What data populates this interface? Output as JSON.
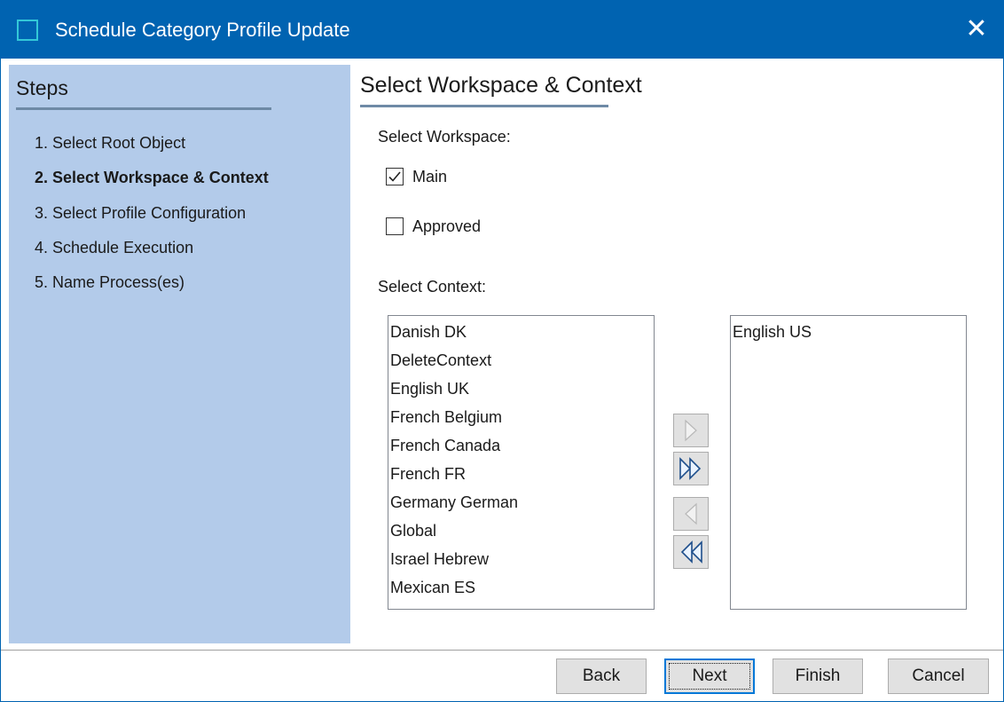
{
  "window": {
    "title": "Schedule Category Profile Update",
    "close_glyph": "✕"
  },
  "steps": {
    "heading": "Steps",
    "items": [
      {
        "label": "1. Select Root Object",
        "active": false
      },
      {
        "label": "2. Select Workspace & Context",
        "active": true
      },
      {
        "label": "3. Select Profile Configuration",
        "active": false
      },
      {
        "label": "4. Schedule Execution",
        "active": false
      },
      {
        "label": "5. Name Process(es)",
        "active": false
      }
    ]
  },
  "main": {
    "heading": "Select Workspace & Context",
    "workspace_label": "Select Workspace:",
    "workspaces": [
      {
        "label": "Main",
        "checked": true
      },
      {
        "label": "Approved",
        "checked": false
      }
    ],
    "context_label": "Select Context:",
    "available_contexts": [
      "Danish DK",
      "DeleteContext",
      "English UK",
      "French Belgium",
      "French Canada",
      "French FR",
      "Germany German",
      "Global",
      "Israel Hebrew",
      "Mexican ES"
    ],
    "selected_contexts": [
      "English US"
    ],
    "move_buttons": [
      {
        "icon": "arrow-right-icon",
        "enabled": false
      },
      {
        "icon": "double-arrow-right-icon",
        "enabled": true
      },
      {
        "icon": "arrow-left-icon",
        "enabled": false
      },
      {
        "icon": "double-arrow-left-icon",
        "enabled": true
      }
    ]
  },
  "footer": {
    "back_label": "Back",
    "next_label": "Next",
    "finish_label": "Finish",
    "cancel_label": "Cancel"
  },
  "colors": {
    "titlebar": "#0063b1",
    "steps_panel": "#b3cbea",
    "accent_focus": "#0078d7"
  }
}
